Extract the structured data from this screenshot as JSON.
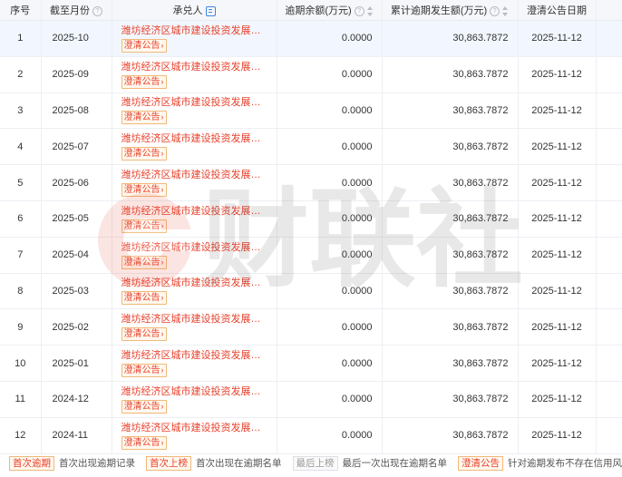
{
  "headers": {
    "index": "序号",
    "month": "截至月份",
    "acceptor": "承兑人",
    "overdue_balance": "逾期余额(万元)",
    "cumulative": "累计逾期发生额(万元)",
    "clear_date": "澄清公告日期"
  },
  "watermark_text": "财联社",
  "rows": [
    {
      "index": "1",
      "month": "2025-10",
      "acceptor": "潍坊经济区城市建设投资发展集...",
      "tag": "澄清公告",
      "balance": "0.0000",
      "cumulative": "30,863.7872",
      "date": "2025-11-12"
    },
    {
      "index": "2",
      "month": "2025-09",
      "acceptor": "潍坊经济区城市建设投资发展集...",
      "tag": "澄清公告",
      "balance": "0.0000",
      "cumulative": "30,863.7872",
      "date": "2025-11-12"
    },
    {
      "index": "3",
      "month": "2025-08",
      "acceptor": "潍坊经济区城市建设投资发展集...",
      "tag": "澄清公告",
      "balance": "0.0000",
      "cumulative": "30,863.7872",
      "date": "2025-11-12"
    },
    {
      "index": "4",
      "month": "2025-07",
      "acceptor": "潍坊经济区城市建设投资发展集...",
      "tag": "澄清公告",
      "balance": "0.0000",
      "cumulative": "30,863.7872",
      "date": "2025-11-12"
    },
    {
      "index": "5",
      "month": "2025-06",
      "acceptor": "潍坊经济区城市建设投资发展集...",
      "tag": "澄清公告",
      "balance": "0.0000",
      "cumulative": "30,863.7872",
      "date": "2025-11-12"
    },
    {
      "index": "6",
      "month": "2025-05",
      "acceptor": "潍坊经济区城市建设投资发展集...",
      "tag": "澄清公告",
      "balance": "0.0000",
      "cumulative": "30,863.7872",
      "date": "2025-11-12"
    },
    {
      "index": "7",
      "month": "2025-04",
      "acceptor": "潍坊经济区城市建设投资发展集...",
      "tag": "澄清公告",
      "balance": "0.0000",
      "cumulative": "30,863.7872",
      "date": "2025-11-12"
    },
    {
      "index": "8",
      "month": "2025-03",
      "acceptor": "潍坊经济区城市建设投资发展集...",
      "tag": "澄清公告",
      "balance": "0.0000",
      "cumulative": "30,863.7872",
      "date": "2025-11-12"
    },
    {
      "index": "9",
      "month": "2025-02",
      "acceptor": "潍坊经济区城市建设投资发展集...",
      "tag": "澄清公告",
      "balance": "0.0000",
      "cumulative": "30,863.7872",
      "date": "2025-11-12"
    },
    {
      "index": "10",
      "month": "2025-01",
      "acceptor": "潍坊经济区城市建设投资发展集...",
      "tag": "澄清公告",
      "balance": "0.0000",
      "cumulative": "30,863.7872",
      "date": "2025-11-12"
    },
    {
      "index": "11",
      "month": "2024-12",
      "acceptor": "潍坊经济区城市建设投资发展集...",
      "tag": "澄清公告",
      "balance": "0.0000",
      "cumulative": "30,863.7872",
      "date": "2025-11-12"
    },
    {
      "index": "12",
      "month": "2024-11",
      "acceptor": "潍坊经济区城市建设投资发展集...",
      "tag": "澄清公告",
      "balance": "0.0000",
      "cumulative": "30,863.7872",
      "date": "2025-11-12"
    }
  ],
  "legend": [
    {
      "tag": "首次逾期",
      "text": "首次出现逾期记录",
      "style": "orange"
    },
    {
      "tag": "首次上榜",
      "text": "首次出现在逾期名单",
      "style": "orange"
    },
    {
      "tag": "最后上榜",
      "text": "最后一次出现在逾期名单",
      "style": "gray"
    },
    {
      "tag": "澄清公告",
      "text": "针对逾期发布不存在信用风险说明",
      "style": "orange"
    }
  ],
  "colors": {
    "accent_red": "#e8412c",
    "tag_border": "#f2b87a",
    "link_blue": "#3f86e8",
    "header_bg": "#f5f7fa"
  }
}
